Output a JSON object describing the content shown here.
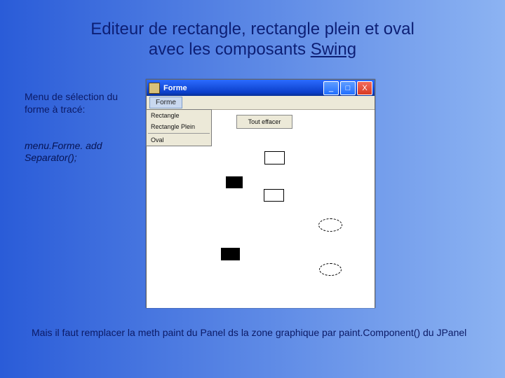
{
  "title": {
    "line1": "Editeur de rectangle, rectangle plein et oval",
    "line2_a": "avec les composants ",
    "line2_b_underlined": "Swing"
  },
  "caption1": "Menu de sélection du forme à tracé:",
  "caption2_a": " menu.Forme. add",
  "caption2_b": "Separator();",
  "footer": "Mais il faut remplacer la meth paint du Panel ds la zone graphique par paint.Component() du JPanel",
  "window": {
    "title": "Forme",
    "menubar": {
      "item": "Forme"
    },
    "dropdown": {
      "items": [
        "Rectangle",
        "Rectangle Plein",
        "Oval"
      ]
    },
    "clear_btn": "Tout effacer",
    "btn": {
      "min": "_",
      "max": "□",
      "close": "X"
    }
  }
}
